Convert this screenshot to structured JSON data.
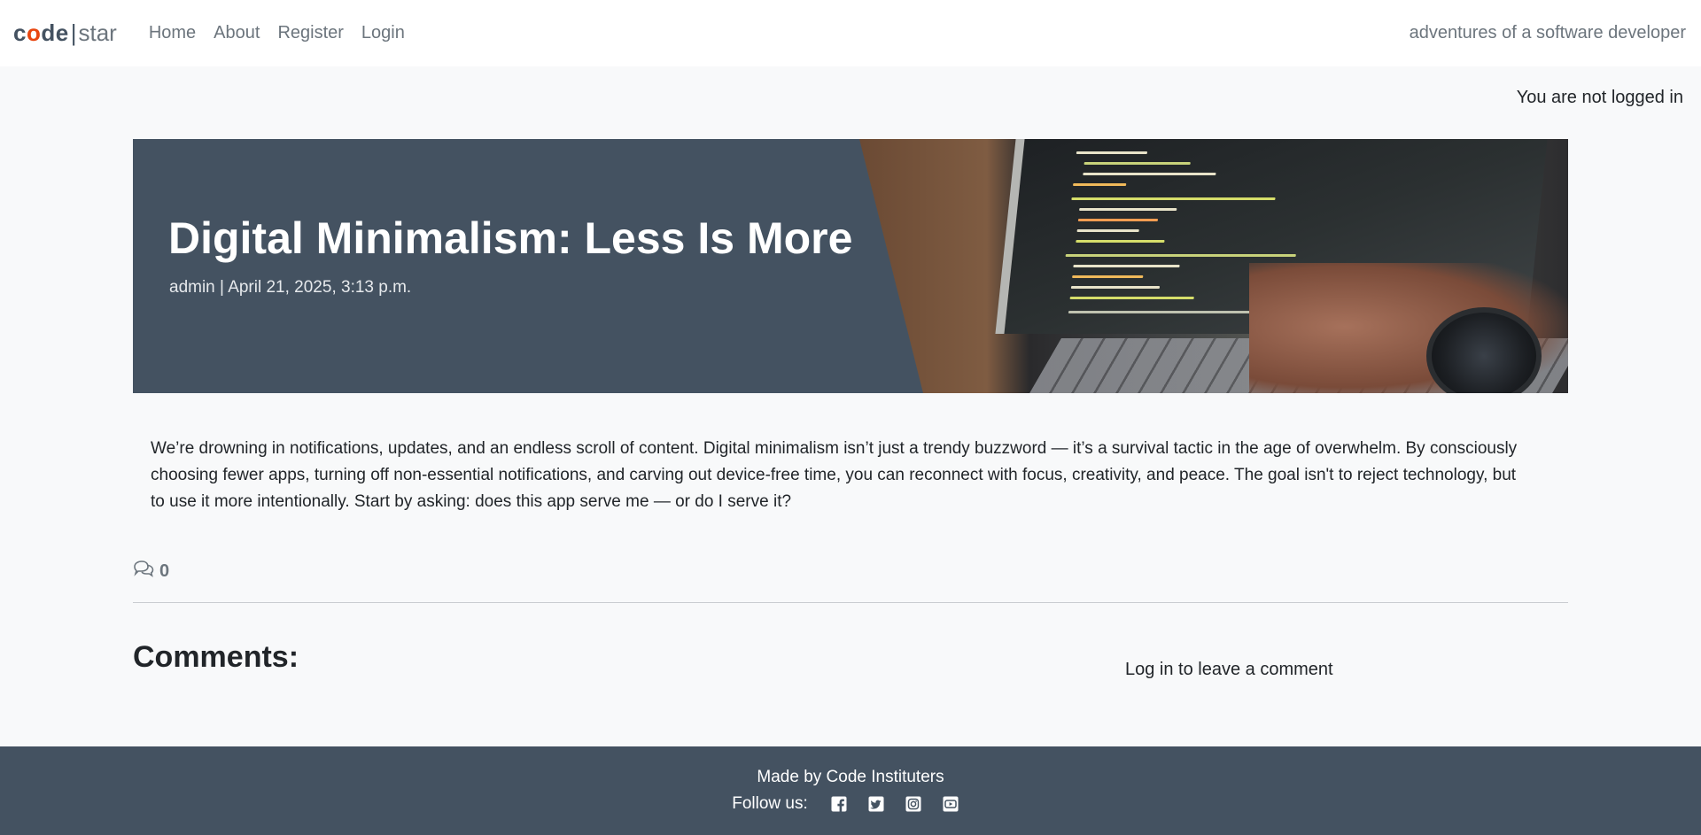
{
  "nav": {
    "brand_code": "code",
    "brand_sep": "|",
    "brand_star": "star",
    "links": [
      "Home",
      "About",
      "Register",
      "Login"
    ],
    "tagline": "adventures of a software developer"
  },
  "login_status": "You are not logged in",
  "post": {
    "title": "Digital Minimalism: Less Is More",
    "meta": "admin | April 21, 2025, 3:13 p.m.",
    "body": "We’re drowning in notifications, updates, and an endless scroll of content. Digital minimalism isn’t just a trendy buzzword — it’s a survival tactic in the age of overwhelm. By consciously choosing fewer apps, turning off non-essential notifications, and carving out device-free time, you can reconnect with focus, creativity, and peace. The goal isn't to reject technology, but to use it more intentionally. Start by asking: does this app serve me — or do I serve it?",
    "comment_count": "0",
    "comment_icon": "chat-bubbles-icon"
  },
  "comments": {
    "heading": "Comments:",
    "login_prompt": "Log in to leave a comment"
  },
  "footer": {
    "made_by": "Made by Code Instituters",
    "follow_label": "Follow us:",
    "social_icons": [
      "facebook-icon",
      "twitter-icon",
      "instagram-icon",
      "youtube-icon"
    ]
  },
  "colors": {
    "brand_dark": "#445261",
    "brand_accent": "#e84610",
    "page_bg": "#f8f9fa",
    "muted_text": "#6c757d"
  }
}
